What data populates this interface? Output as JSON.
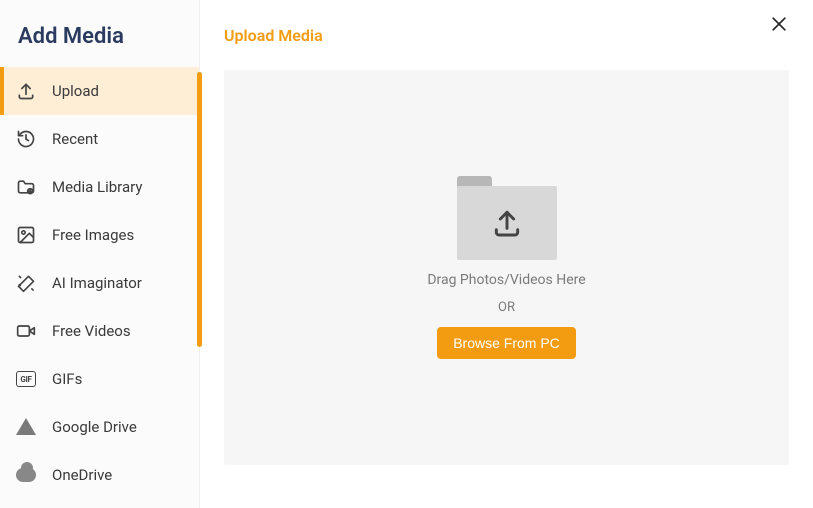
{
  "sidebar": {
    "title": "Add Media",
    "items": [
      {
        "label": "Upload",
        "icon": "upload-icon",
        "active": true
      },
      {
        "label": "Recent",
        "icon": "history-icon",
        "active": false
      },
      {
        "label": "Media Library",
        "icon": "folder-icon",
        "active": false
      },
      {
        "label": "Free Images",
        "icon": "image-icon",
        "active": false
      },
      {
        "label": "AI Imaginator",
        "icon": "magic-icon",
        "active": false
      },
      {
        "label": "Free Videos",
        "icon": "video-icon",
        "active": false
      },
      {
        "label": "GIFs",
        "icon": "gif-icon",
        "active": false
      },
      {
        "label": "Google Drive",
        "icon": "gdrive-icon",
        "active": false
      },
      {
        "label": "OneDrive",
        "icon": "onedrive-icon",
        "active": false
      }
    ]
  },
  "main": {
    "title": "Upload Media",
    "drop_text": "Drag Photos/Videos Here",
    "or_text": "OR",
    "browse_label": "Browse From PC"
  },
  "colors": {
    "accent": "#f39c12",
    "sidebar_active_bg": "#ffeed6",
    "dropzone_bg": "#f6f6f6"
  }
}
